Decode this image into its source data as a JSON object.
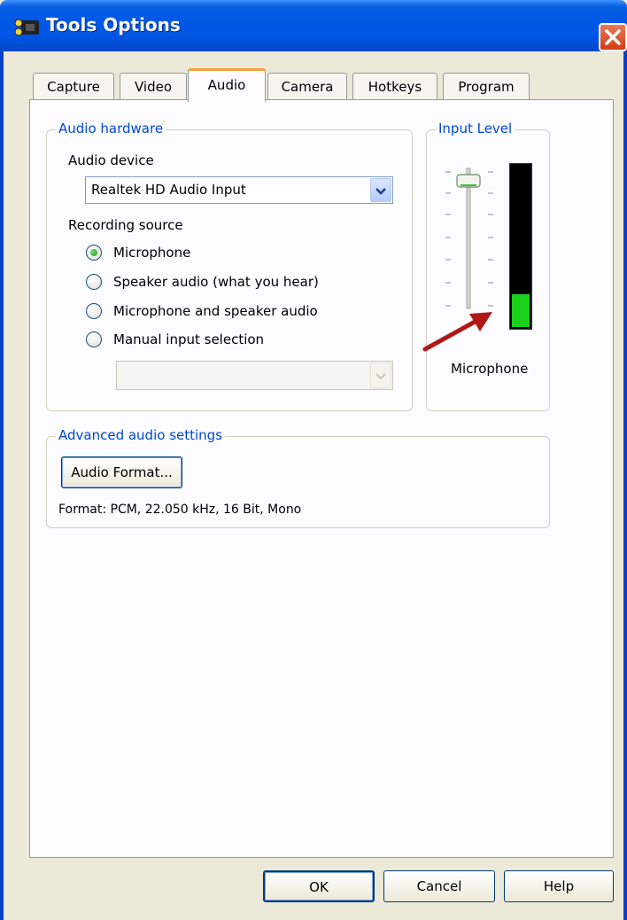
{
  "window": {
    "title": "Tools Options"
  },
  "tabs": [
    {
      "label": "Capture",
      "active": false
    },
    {
      "label": "Video",
      "active": false
    },
    {
      "label": "Audio",
      "active": true
    },
    {
      "label": "Camera",
      "active": false
    },
    {
      "label": "Hotkeys",
      "active": false
    },
    {
      "label": "Program",
      "active": false
    }
  ],
  "audio_hardware": {
    "group_title": "Audio hardware",
    "device_label": "Audio device",
    "device_value": "Realtek HD Audio Input",
    "source_label": "Recording source",
    "sources": [
      {
        "label": "Microphone",
        "selected": true
      },
      {
        "label": "Speaker audio (what you hear)",
        "selected": false
      },
      {
        "label": "Microphone and speaker audio",
        "selected": false
      },
      {
        "label": "Manual input selection",
        "selected": false
      }
    ],
    "manual_input_value": ""
  },
  "input_level": {
    "group_title": "Input Level",
    "source_name": "Microphone",
    "meter_fraction": 0.2,
    "slider_fraction": 0.95,
    "meter_color": "#1cd11c"
  },
  "advanced": {
    "group_title": "Advanced audio settings",
    "format_button": "Audio Format...",
    "format_text": "Format: PCM, 22.050 kHz, 16 Bit, Mono"
  },
  "buttons": {
    "ok": "OK",
    "cancel": "Cancel",
    "help": "Help"
  },
  "colors": {
    "title_bar": "#0055e5",
    "group_title": "#0046d5",
    "active_tab_accent": "#f2a13a",
    "arrow": "#b01818"
  }
}
